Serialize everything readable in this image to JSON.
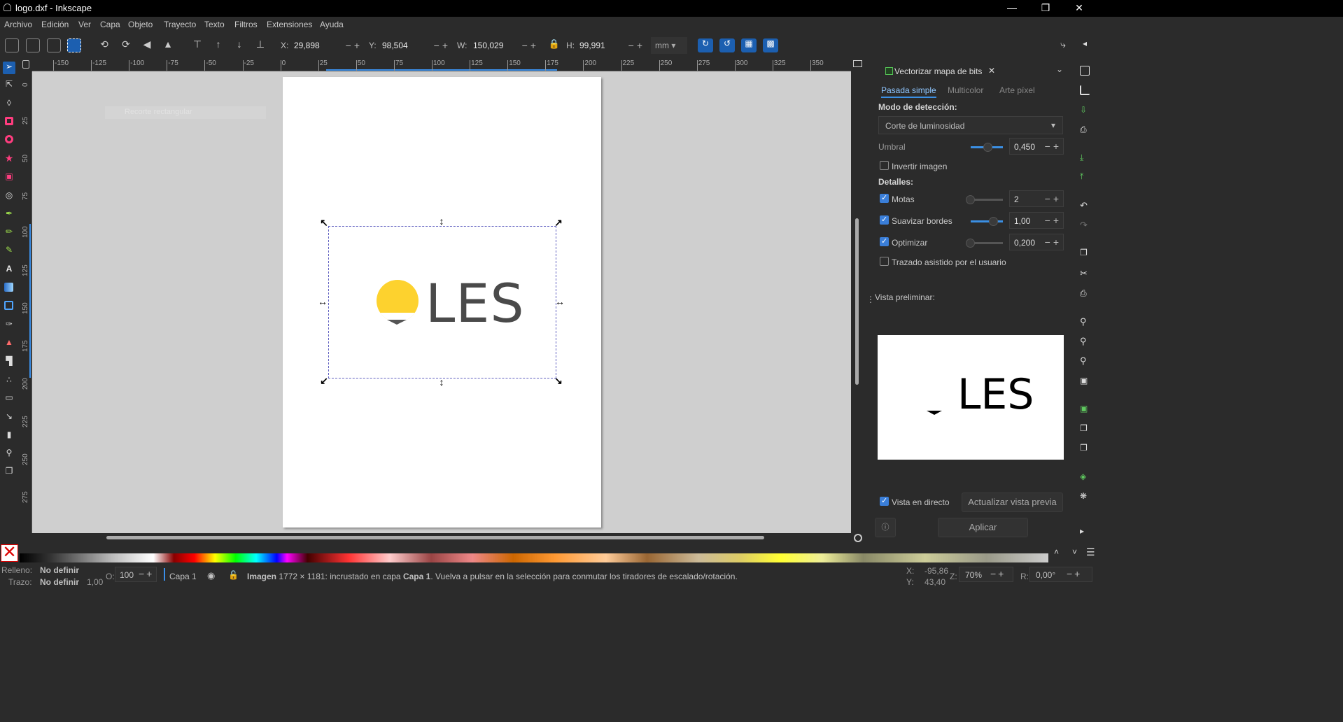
{
  "window": {
    "title": "logo.dxf - Inkscape"
  },
  "menu": [
    "Archivo",
    "Edición",
    "Ver",
    "Capa",
    "Objeto",
    "Trayecto",
    "Texto",
    "Filtros",
    "Extensiones",
    "Ayuda"
  ],
  "toolbar": {
    "x_label": "X:",
    "x_value": "29,898",
    "y_label": "Y:",
    "y_value": "98,504",
    "w_label": "W:",
    "w_value": "150,029",
    "h_label": "H:",
    "h_value": "99,991",
    "unit": "mm"
  },
  "ruler": {
    "h_ticks": [
      "-150",
      "-125",
      "-100",
      "-75",
      "-50",
      "-25",
      "0",
      "25",
      "50",
      "75",
      "100",
      "125",
      "150",
      "175",
      "200",
      "225",
      "250",
      "275",
      "300",
      "325",
      "350"
    ],
    "v_ticks": [
      "0",
      "25",
      "50",
      "75",
      "100",
      "125",
      "150",
      "175",
      "200",
      "225",
      "250",
      "275"
    ]
  },
  "canvas": {
    "ghost_tool_label": "Recorte rectangular",
    "logo_text": "LES"
  },
  "panel": {
    "tab_title": "Vectorizar mapa de bits",
    "subtabs": [
      "Pasada simple",
      "Multicolor",
      "Arte píxel"
    ],
    "mode_label": "Modo de detección:",
    "mode_value": "Corte de luminosidad",
    "threshold_label": "Umbral",
    "threshold_value": "0,450",
    "invert_label": "Invertir imagen",
    "details_label": "Detalles:",
    "speckles_label": "Motas",
    "speckles_value": "2",
    "smooth_label": "Suavizar bordes",
    "smooth_value": "1,00",
    "optimize_label": "Optimizar",
    "optimize_value": "0,200",
    "assisted_label": "Trazado asistido por el usuario",
    "preview_label": "Vista preliminar:",
    "preview_text": "LES",
    "live_label": "Vista en directo",
    "update_button": "Actualizar vista previa",
    "apply_button": "Aplicar"
  },
  "status": {
    "fill_label": "Relleno:",
    "fill_value": "No definir",
    "stroke_label": "Trazo:",
    "stroke_value": "No definir",
    "stroke_width": "1,00",
    "opacity_label": "O:",
    "opacity_value": "100",
    "layer_value": "Capa 1",
    "msg_bold1": "Imagen",
    "msg_part1": "1772 × 1181: incrustado en capa",
    "msg_bold2": "Capa 1",
    "msg_part2": ". Vuelva a pulsar en la selección para conmutar los tiradores de escalado/rotación.",
    "coord_x_label": "X:",
    "coord_x": "-95,86",
    "coord_y_label": "Y:",
    "coord_y": "43,40",
    "zoom_label": "Z:",
    "zoom_value": "70%",
    "rotation_label": "R:",
    "rotation_value": "0,00°"
  }
}
